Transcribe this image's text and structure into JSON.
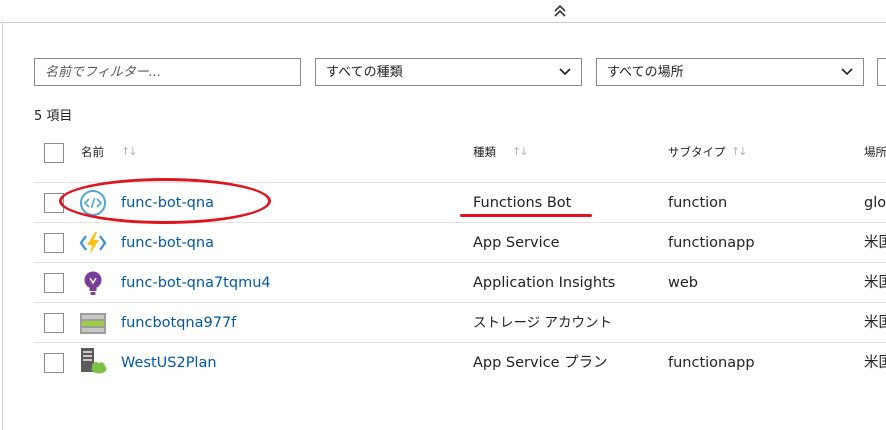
{
  "filters": {
    "name_placeholder": "名前でフィルター...",
    "type_selected": "すべての種類",
    "location_selected": "すべての場所"
  },
  "item_count": "5 項目",
  "columns": {
    "name": "名前",
    "type": "種類",
    "subtype": "サブタイプ",
    "location": "場所"
  },
  "rows": [
    {
      "name": "func-bot-qna",
      "type": "Functions Bot",
      "subtype": "function",
      "location": "glo",
      "icon": "bot-service-icon"
    },
    {
      "name": "func-bot-qna",
      "type": "App Service",
      "subtype": "functionapp",
      "location": "米国",
      "icon": "function-app-icon"
    },
    {
      "name": "func-bot-qna7tqmu4",
      "type": "Application Insights",
      "subtype": "web",
      "location": "米国",
      "icon": "application-insights-icon"
    },
    {
      "name": "funcbotqna977f",
      "type": "ストレージ アカウント",
      "subtype": "",
      "location": "米国",
      "icon": "storage-account-icon"
    },
    {
      "name": "WestUS2Plan",
      "type": "App Service プラン",
      "subtype": "functionapp",
      "location": "米国",
      "icon": "app-service-plan-icon"
    }
  ],
  "sort_glyph": "↑↓",
  "colors": {
    "link": "#0058a6",
    "annotation": "#e0141e"
  }
}
